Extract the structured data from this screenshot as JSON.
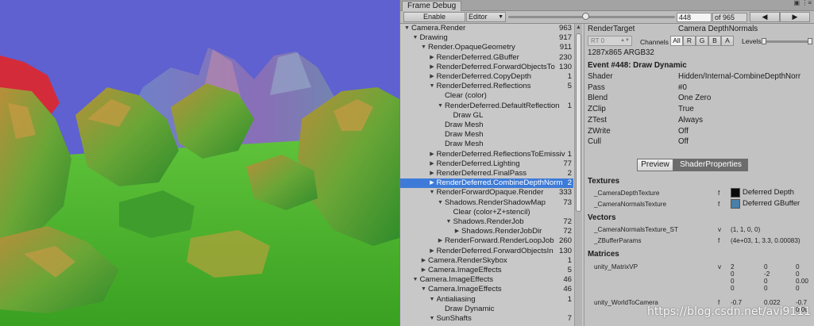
{
  "window": {
    "tab_title": "Frame Debug",
    "menu_icons": "▣ ⋮≡"
  },
  "toolbar": {
    "enable_label": "Enable",
    "target_label": "Editor",
    "event_value": "448",
    "event_total": "of 965",
    "prev_icon": "left-triangle-icon",
    "next_icon": "right-triangle-icon",
    "slider_position_fraction": 0.464
  },
  "tree": {
    "selected_index": 16,
    "items": [
      {
        "label": "Camera.Render",
        "count": "963",
        "depth": 0,
        "expander": "open"
      },
      {
        "label": "Drawing",
        "count": "917",
        "depth": 1,
        "expander": "open"
      },
      {
        "label": "Render.OpaqueGeometry",
        "count": "911",
        "depth": 2,
        "expander": "open"
      },
      {
        "label": "RenderDeferred.GBuffer",
        "count": "230",
        "depth": 3,
        "expander": "closed"
      },
      {
        "label": "RenderDeferred.ForwardObjectsTo",
        "count": "130",
        "depth": 3,
        "expander": "closed"
      },
      {
        "label": "RenderDeferred.CopyDepth",
        "count": "1",
        "depth": 3,
        "expander": "closed"
      },
      {
        "label": "RenderDeferred.Reflections",
        "count": "5",
        "depth": 3,
        "expander": "open"
      },
      {
        "label": "Clear (color)",
        "count": "",
        "depth": 4,
        "expander": "none"
      },
      {
        "label": "RenderDeferred.DefaultReflection",
        "count": "1",
        "depth": 4,
        "expander": "open"
      },
      {
        "label": "Draw GL",
        "count": "",
        "depth": 5,
        "expander": "none"
      },
      {
        "label": "Draw Mesh",
        "count": "",
        "depth": 4,
        "expander": "none"
      },
      {
        "label": "Draw Mesh",
        "count": "",
        "depth": 4,
        "expander": "none"
      },
      {
        "label": "Draw Mesh",
        "count": "",
        "depth": 4,
        "expander": "none"
      },
      {
        "label": "RenderDeferred.ReflectionsToEmissiv",
        "count": "1",
        "depth": 3,
        "expander": "closed"
      },
      {
        "label": "RenderDeferred.Lighting",
        "count": "77",
        "depth": 3,
        "expander": "closed"
      },
      {
        "label": "RenderDeferred.FinalPass",
        "count": "2",
        "depth": 3,
        "expander": "closed"
      },
      {
        "label": "RenderDeferred.CombineDepthNorm",
        "count": "2",
        "depth": 3,
        "expander": "closed"
      },
      {
        "label": "RenderForwardOpaque.Render",
        "count": "333",
        "depth": 3,
        "expander": "open"
      },
      {
        "label": "Shadows.RenderShadowMap",
        "count": "73",
        "depth": 4,
        "expander": "open"
      },
      {
        "label": "Clear (color+Z+stencil)",
        "count": "",
        "depth": 5,
        "expander": "none"
      },
      {
        "label": "Shadows.RenderJob",
        "count": "72",
        "depth": 5,
        "expander": "open"
      },
      {
        "label": "Shadows.RenderJobDir",
        "count": "72",
        "depth": 6,
        "expander": "closed"
      },
      {
        "label": "RenderForward.RenderLoopJob",
        "count": "260",
        "depth": 4,
        "expander": "closed"
      },
      {
        "label": "RenderDeferred.ForwardObjectsIn",
        "count": "130",
        "depth": 3,
        "expander": "closed"
      },
      {
        "label": "Camera.RenderSkybox",
        "count": "1",
        "depth": 2,
        "expander": "closed"
      },
      {
        "label": "Camera.ImageEffects",
        "count": "5",
        "depth": 2,
        "expander": "closed"
      },
      {
        "label": "Camera.ImageEffects",
        "count": "46",
        "depth": 1,
        "expander": "open"
      },
      {
        "label": "Camera.ImageEffects",
        "count": "46",
        "depth": 2,
        "expander": "open"
      },
      {
        "label": "Antialiasing",
        "count": "1",
        "depth": 3,
        "expander": "open"
      },
      {
        "label": "Draw Dynamic",
        "count": "",
        "depth": 4,
        "expander": "none"
      },
      {
        "label": "SunShafts",
        "count": "7",
        "depth": 3,
        "expander": "open"
      }
    ]
  },
  "details": {
    "render_target_label": "RenderTarget",
    "render_target_value": "Camera DepthNormals",
    "rt_select": "RT 0",
    "channels_label": "Channels",
    "channels": [
      "All",
      "R",
      "G",
      "B",
      "A"
    ],
    "channel_selected": "All",
    "levels_label": "Levels",
    "resolution": "1287x865 ARGB32",
    "event_title": "Event #448: Draw Dynamic",
    "properties": [
      {
        "key": "Shader",
        "value": "Hidden/Internal-CombineDepthNorr"
      },
      {
        "key": "Pass",
        "value": "#0"
      },
      {
        "key": "Blend",
        "value": "One Zero"
      },
      {
        "key": "ZClip",
        "value": "True"
      },
      {
        "key": "ZTest",
        "value": "Always"
      },
      {
        "key": "ZWrite",
        "value": "Off"
      },
      {
        "key": "Cull",
        "value": "Off"
      }
    ],
    "preview_label": "Preview",
    "shader_properties_label": "ShaderProperties",
    "textures_header": "Textures",
    "textures": [
      {
        "name": "_CameraDepthTexture",
        "stage": "f",
        "value": "Deferred Depth",
        "swatch": "#0a0a0a"
      },
      {
        "name": "_CameraNormalsTexture",
        "stage": "f",
        "value": "Deferred GBuffer",
        "swatch": "#4a7fa8"
      }
    ],
    "vectors_header": "Vectors",
    "vectors": [
      {
        "name": "_CameraNormalsTexture_ST",
        "stage": "v",
        "value": "(1, 1, 0, 0)"
      },
      {
        "name": "_ZBufferParams",
        "stage": "f",
        "value": "(4e+03, 1, 3.3, 0.00083)"
      }
    ],
    "matrices_header": "Matrices",
    "matrix_vp": {
      "name": "unity_MatrixVP",
      "stage": "v",
      "rows": [
        [
          "2",
          "0",
          "0"
        ],
        [
          "0",
          "-2",
          "0"
        ],
        [
          "0",
          "0",
          "0.00"
        ],
        [
          "0",
          "0",
          "0"
        ]
      ]
    },
    "matrix_w2c": {
      "name": "unity_WorldToCamera",
      "stage": "f",
      "rows": [
        [
          "-0.7",
          "0.022",
          "-0.7"
        ],
        [
          "",
          "",
          "0.00"
        ]
      ]
    }
  },
  "watermark": "https://blog.csdn.net/avi9111"
}
